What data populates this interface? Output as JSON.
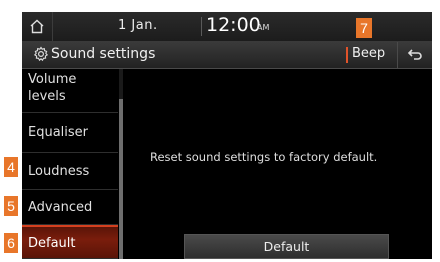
{
  "status_bar": {
    "date": "1 Jan.",
    "time": "12:00",
    "ampm": "AM"
  },
  "title_bar": {
    "title": "Sound settings",
    "beep_label": "Beep"
  },
  "menu": {
    "items": [
      {
        "label_line1": "Volume",
        "label_line2": "levels"
      },
      {
        "label": "Equaliser"
      },
      {
        "label": "Loudness"
      },
      {
        "label": "Advanced"
      },
      {
        "label": "Default",
        "selected": true
      }
    ]
  },
  "content": {
    "message": "Reset sound settings to factory default.",
    "default_button_label": "Default"
  },
  "callouts": {
    "loudness": "4",
    "advanced": "5",
    "default": "6",
    "beep": "7"
  },
  "colors": {
    "accent": "#e8762a",
    "selected_bg": "#7a1d0c",
    "beep_marker": "#e0532a"
  }
}
